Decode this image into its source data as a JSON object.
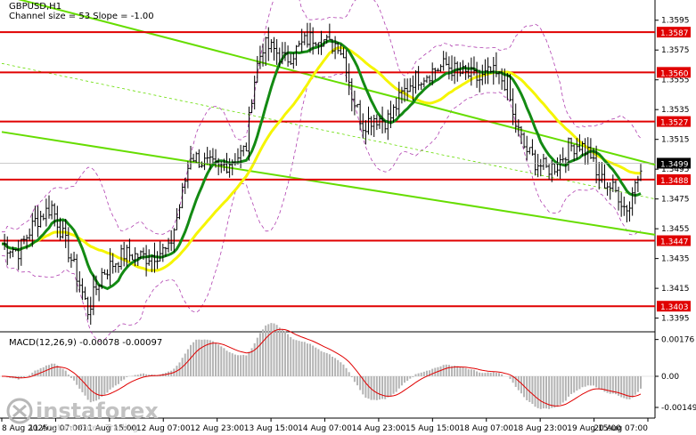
{
  "chart_header": {
    "symbol_line": "GBPUSD,H1",
    "channel_line": "Channel size = 53 Slope = -1.00"
  },
  "macd_header": "MACD(12,26,9) -0.00078 -0.00097",
  "watermark": {
    "brand": "instaforex",
    "tagline": "Instant Forex Trading"
  },
  "colors": {
    "background": "#ffffff",
    "price_bars": "#000000",
    "level_lines": "#e00000",
    "channel": "#66dd00",
    "ma_fast": "#f5f500",
    "ma_slow": "#138a13",
    "bollinger": "#b040b0",
    "macd_hist": "#b4b4b4",
    "macd_signal": "#e00000"
  },
  "chart_data": {
    "type": "candlestick",
    "symbol": "GBPUSD",
    "timeframe": "H1",
    "ylim": [
      1.3387,
      1.3605
    ],
    "y_ticks": [
      1.3595,
      1.3575,
      1.3555,
      1.3535,
      1.3515,
      1.3495,
      1.3475,
      1.3455,
      1.3435,
      1.3415,
      1.3395
    ],
    "x_labels": [
      "8 Aug 2025",
      "11 Aug 07:00",
      "11 Aug 15:00",
      "12 Aug 07:00",
      "12 Aug 23:00",
      "13 Aug 15:00",
      "14 Aug 07:00",
      "14 Aug 23:00",
      "15 Aug 15:00",
      "18 Aug 07:00",
      "18 Aug 23:00",
      "19 Aug 15:00",
      "20 Aug 07:00"
    ],
    "levels": [
      1.3587,
      1.356,
      1.3527,
      1.3488,
      1.3447,
      1.3403
    ],
    "current_price": 1.3499,
    "price_path": [
      [
        0,
        1.3445
      ],
      [
        6,
        1.344
      ],
      [
        12,
        1.346
      ],
      [
        18,
        1.347
      ],
      [
        24,
        1.344
      ],
      [
        28,
        1.3418
      ],
      [
        31,
        1.34
      ],
      [
        36,
        1.3425
      ],
      [
        44,
        1.3438
      ],
      [
        52,
        1.3436
      ],
      [
        58,
        1.344
      ],
      [
        60,
        1.344
      ],
      [
        64,
        1.347
      ],
      [
        68,
        1.3505
      ],
      [
        72,
        1.35
      ],
      [
        78,
        1.3495
      ],
      [
        82,
        1.35
      ],
      [
        86,
        1.3505
      ],
      [
        88,
        1.351
      ],
      [
        90,
        1.3545
      ],
      [
        92,
        1.3565
      ],
      [
        94,
        1.3578
      ],
      [
        98,
        1.3575
      ],
      [
        102,
        1.3568
      ],
      [
        106,
        1.3575
      ],
      [
        110,
        1.3582
      ],
      [
        114,
        1.3585
      ],
      [
        118,
        1.3578
      ],
      [
        121,
        1.358
      ],
      [
        124,
        1.3565
      ],
      [
        126,
        1.3545
      ],
      [
        130,
        1.3525
      ],
      [
        134,
        1.353
      ],
      [
        138,
        1.3528
      ],
      [
        140,
        1.353
      ],
      [
        144,
        1.3545
      ],
      [
        148,
        1.3555
      ],
      [
        152,
        1.3558
      ],
      [
        156,
        1.3562
      ],
      [
        160,
        1.3565
      ],
      [
        164,
        1.356
      ],
      [
        168,
        1.3558
      ],
      [
        172,
        1.3555
      ],
      [
        176,
        1.356
      ],
      [
        180,
        1.3555
      ],
      [
        182,
        1.3552
      ],
      [
        184,
        1.353
      ],
      [
        188,
        1.351
      ],
      [
        192,
        1.35
      ],
      [
        196,
        1.3495
      ],
      [
        200,
        1.3498
      ],
      [
        204,
        1.351
      ],
      [
        208,
        1.3512
      ],
      [
        212,
        1.3505
      ],
      [
        214,
        1.349
      ],
      [
        218,
        1.3485
      ],
      [
        222,
        1.3478
      ],
      [
        224,
        1.347
      ],
      [
        226,
        1.347
      ],
      [
        228,
        1.3488
      ],
      [
        230,
        1.3499
      ]
    ],
    "x_max": 230,
    "channel_upper": [
      [
        0,
        1.3612
      ],
      [
        230,
        1.3498
      ]
    ],
    "channel_lower": [
      [
        0,
        1.352
      ],
      [
        230,
        1.3451
      ]
    ],
    "channel_mid": [
      [
        0,
        1.3566
      ],
      [
        230,
        1.3475
      ]
    ],
    "macd_ylim": [
      -0.002,
      0.002
    ],
    "macd_ticks": [
      0.00176,
      0.0,
      -0.00149
    ],
    "macd_tick_labels": [
      "0.00176",
      "0.00",
      "-0.00149"
    ]
  }
}
